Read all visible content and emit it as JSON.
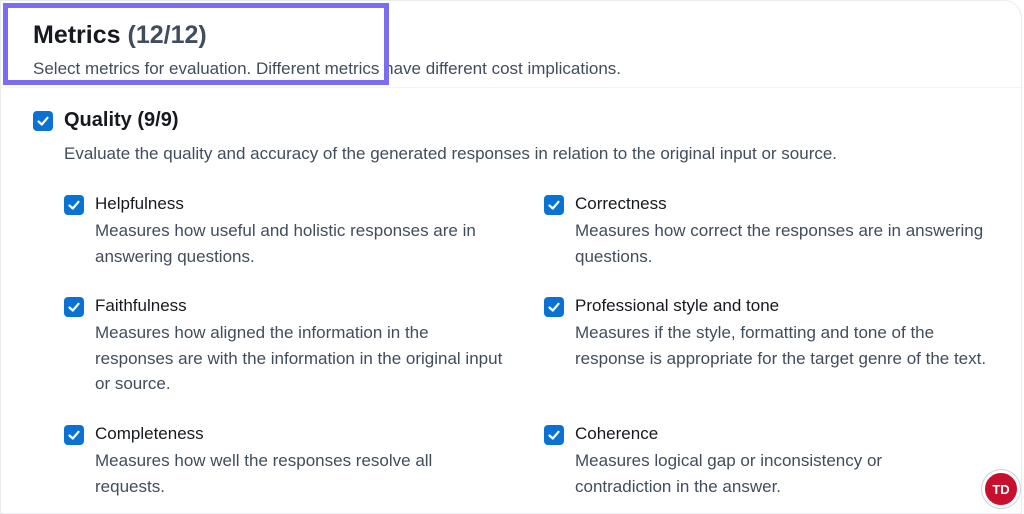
{
  "header": {
    "title": "Metrics",
    "count": "(12/12)",
    "description": "Select metrics for evaluation. Different metrics have different cost implications."
  },
  "quality": {
    "title": "Quality (9/9)",
    "description": "Evaluate the quality and accuracy of the generated responses in relation to the original input or source.",
    "checked": true
  },
  "metrics": [
    {
      "title": "Helpfulness",
      "description": "Measures how useful and holistic responses are in answering questions.",
      "checked": true
    },
    {
      "title": "Correctness",
      "description": "Measures how correct the responses are in answering questions.",
      "checked": true
    },
    {
      "title": "Faithfulness",
      "description": "Measures how aligned the information in the responses are with the information in the original input or source.",
      "checked": true
    },
    {
      "title": "Professional style and tone",
      "description": "Measures if the style, formatting and tone of the response is appropriate for the target genre of the text.",
      "checked": true
    },
    {
      "title": "Completeness",
      "description": "Measures how well the responses resolve all requests.",
      "checked": true
    },
    {
      "title": "Coherence",
      "description": "Measures logical gap or inconsistency or contradiction in the answer.",
      "checked": true
    }
  ],
  "watermark": {
    "text": "TD"
  },
  "colors": {
    "checkbox": "#0972d3",
    "highlight": "#7b6cf0",
    "badge": "#c8102e"
  },
  "icons": {
    "checkbox": "check-icon"
  }
}
